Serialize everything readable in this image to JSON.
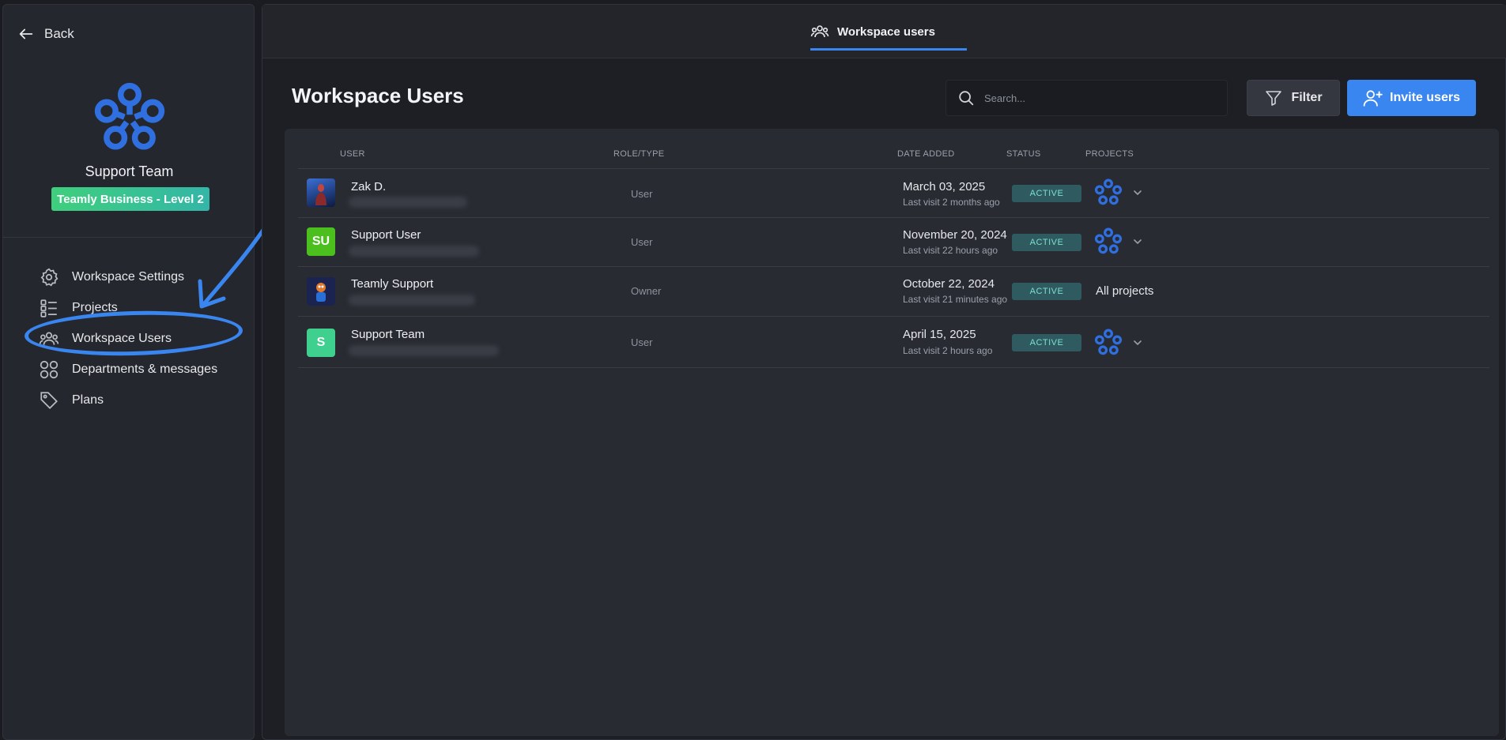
{
  "sidebar": {
    "back_label": "Back",
    "workspace_name": "Support Team",
    "plan_badge": "Teamly Business - Level 2",
    "nav": [
      {
        "label": "Workspace Settings",
        "icon": "gear-icon"
      },
      {
        "label": "Projects",
        "icon": "list-icon"
      },
      {
        "label": "Workspace Users",
        "icon": "users-icon"
      },
      {
        "label": "Departments & messages",
        "icon": "grid-circles-icon"
      },
      {
        "label": "Plans",
        "icon": "tag-icon"
      }
    ]
  },
  "topbar": {
    "tab_label": "Workspace users"
  },
  "main": {
    "title": "Workspace Users",
    "search_placeholder": "Search...",
    "filter_label": "Filter",
    "invite_label": "Invite users"
  },
  "table": {
    "headers": {
      "user": "USER",
      "role": "ROLE/TYPE",
      "date_added": "DATE ADDED",
      "status": "STATUS",
      "projects": "PROJECTS"
    },
    "rows": [
      {
        "name": "Zak D.",
        "avatar_text": "",
        "avatar_color": "#1f3f8a",
        "role": "User",
        "date": "March 03, 2025",
        "last_visit": "Last visit 2 months ago",
        "status": "ACTIVE",
        "projects": ""
      },
      {
        "name": "Support User",
        "avatar_text": "SU",
        "avatar_color": "#4bbf1e",
        "role": "User",
        "date": "November 20, 2024",
        "last_visit": "Last visit 22 hours ago",
        "status": "ACTIVE",
        "projects": ""
      },
      {
        "name": "Teamly Support",
        "avatar_text": "",
        "avatar_color": "#1b2350",
        "role": "Owner",
        "date": "October 22, 2024",
        "last_visit": "Last visit 21 minutes ago",
        "status": "ACTIVE",
        "projects": "All projects"
      },
      {
        "name": "Support Team",
        "avatar_text": "S",
        "avatar_color": "#3fcf8e",
        "role": "User",
        "date": "April 15, 2025",
        "last_visit": "Last visit 2 hours ago",
        "status": "ACTIVE",
        "projects": ""
      }
    ]
  },
  "colors": {
    "accent": "#3a86f0",
    "status_bg": "#2e5a60",
    "status_text": "#7ee0d0",
    "badge_gradient_start": "#3fcf7d",
    "badge_gradient_end": "#33b6a8"
  }
}
